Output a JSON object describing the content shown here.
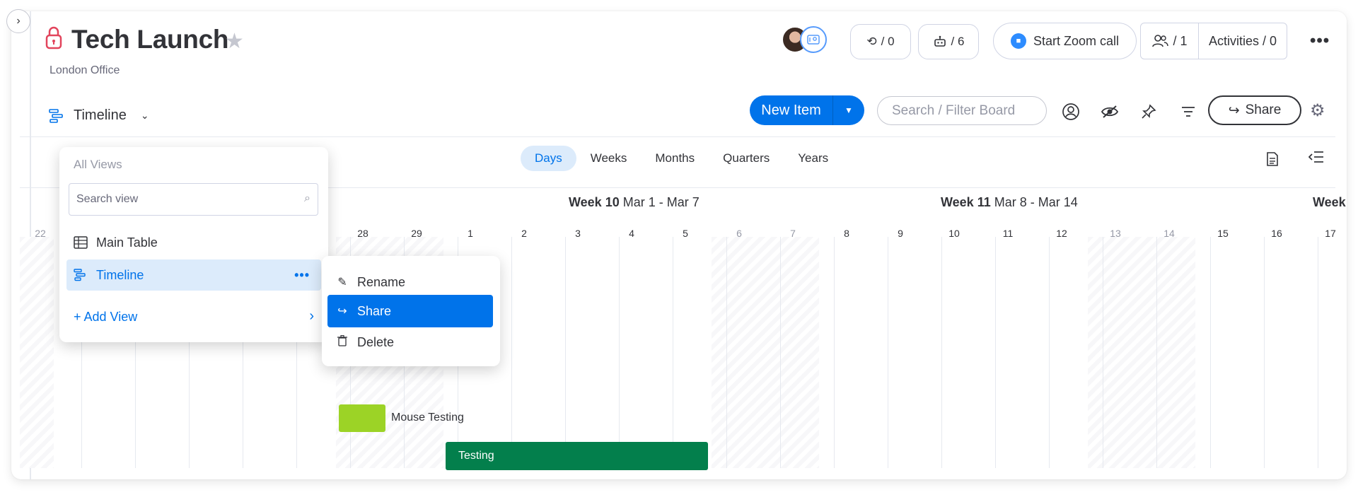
{
  "board": {
    "title": "Tech Launch",
    "workspace": "London Office"
  },
  "header": {
    "integrations_count": "/ 0",
    "automations_count": "/ 6",
    "zoom_label": "Start Zoom call",
    "members_count": "/ 1",
    "activities_label": "Activities / 0"
  },
  "toolbar": {
    "view_label": "Timeline",
    "new_item_label": "New Item",
    "search_placeholder": "Search / Filter Board",
    "share_label": "Share"
  },
  "zoom_tabs": [
    {
      "label": "Days",
      "active": true
    },
    {
      "label": "Weeks",
      "active": false
    },
    {
      "label": "Months",
      "active": false
    },
    {
      "label": "Quarters",
      "active": false
    },
    {
      "label": "Years",
      "active": false
    }
  ],
  "weeks": [
    {
      "name": "Week 10",
      "range": "Mar 1 - Mar 7"
    },
    {
      "name": "Week 11",
      "range": "Mar 8 - Mar 14"
    },
    {
      "name": "Week",
      "range": ""
    }
  ],
  "days": [
    "22",
    "",
    "",
    "",
    "",
    "",
    "28",
    "29",
    "1",
    "2",
    "3",
    "4",
    "5",
    "6",
    "7",
    "8",
    "9",
    "10",
    "11",
    "12",
    "13",
    "14",
    "15",
    "16",
    "17"
  ],
  "items": {
    "item1": "Mouse Testing",
    "item2": "Testing"
  },
  "views_panel": {
    "header": "All Views",
    "search_placeholder": "Search view",
    "items": [
      {
        "label": "Main Table"
      },
      {
        "label": "Timeline"
      }
    ],
    "add_view": "+ Add View"
  },
  "context_menu": {
    "items": [
      {
        "label": "Rename"
      },
      {
        "label": "Share"
      },
      {
        "label": "Delete"
      }
    ]
  },
  "colors": {
    "accent": "#0073ea",
    "item_light_green": "#9cd326",
    "item_dark_green": "#037f4c"
  }
}
